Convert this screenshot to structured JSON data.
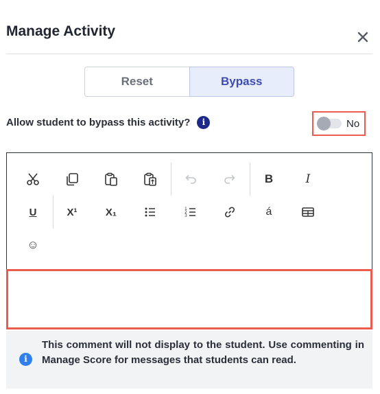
{
  "dialog": {
    "title": "Manage Activity",
    "close_icon": "close-icon"
  },
  "segmented": {
    "options": [
      "Reset",
      "Bypass"
    ],
    "selected": "Bypass"
  },
  "bypass": {
    "question": "Allow student to bypass this activity?",
    "info_icon_text": "i",
    "toggle_state": "off",
    "toggle_label": "No"
  },
  "toolbar": {
    "buttons": [
      {
        "icon": "cut-icon"
      },
      {
        "icon": "copy-icon"
      },
      {
        "icon": "paste-icon"
      },
      {
        "icon": "paste-special-icon"
      },
      {
        "icon": "undo-icon",
        "disabled": true
      },
      {
        "icon": "redo-icon",
        "disabled": true
      },
      {
        "icon": "bold-icon",
        "text": "B"
      },
      {
        "icon": "italic-icon",
        "text": "I"
      },
      {
        "icon": "underline-icon",
        "text": "U"
      },
      {
        "icon": "superscript-icon",
        "text": "X¹"
      },
      {
        "icon": "subscript-icon",
        "text": "X₁"
      },
      {
        "icon": "bulleted-list-icon"
      },
      {
        "icon": "numbered-list-icon"
      },
      {
        "icon": "link-icon"
      },
      {
        "icon": "special-character-icon",
        "text": "á"
      },
      {
        "icon": "table-icon"
      },
      {
        "icon": "emoji-icon",
        "text": "☺"
      }
    ]
  },
  "comment": {
    "value": ""
  },
  "note": {
    "icon_text": "i",
    "text": "This comment will not display to the student. Use commenting in Manage Score for messages that students can read."
  },
  "colors": {
    "accent": "#3d4bb3",
    "highlight": "#ec5b4f",
    "info_dark": "#1e2a8a",
    "info_blue": "#2f80ed"
  }
}
